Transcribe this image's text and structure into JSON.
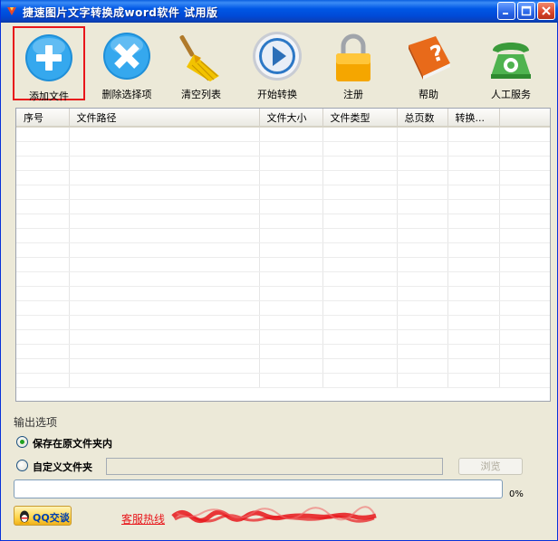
{
  "window": {
    "title": "捷速图片文字转换成word软件 试用版",
    "controls": [
      "minimize-icon",
      "maximize-icon",
      "close-icon"
    ]
  },
  "toolbar": {
    "items": [
      {
        "label": "添加文件",
        "icon": "add-plus-icon",
        "selected": true
      },
      {
        "label": "删除选择项",
        "icon": "delete-x-icon",
        "selected": false
      },
      {
        "label": "清空列表",
        "icon": "broom-icon",
        "selected": false
      },
      {
        "label": "开始转换",
        "icon": "play-icon",
        "selected": false
      },
      {
        "label": "注册",
        "icon": "lock-icon",
        "selected": false
      },
      {
        "label": "帮助",
        "icon": "help-book-icon",
        "selected": false
      },
      {
        "label": "人工服务",
        "icon": "telephone-icon",
        "selected": false
      }
    ]
  },
  "file_list": {
    "columns": [
      "序号",
      "文件路径",
      "文件大小",
      "文件类型",
      "总页数",
      "转换..."
    ],
    "rows": []
  },
  "output": {
    "section_title": "输出选项",
    "option_same_folder": "保存在原文件夹内",
    "option_custom_folder": "自定义文件夹",
    "selected_option": "保存在原文件夹内",
    "custom_folder_value": "",
    "browse_label": "浏览"
  },
  "progress": {
    "value_percent": 0,
    "label": "0%"
  },
  "footer": {
    "qq_button_label": "QQ交谈",
    "hotline_label": "客服热线"
  },
  "colors": {
    "titlebar": "#0058e6",
    "selection_border": "#e8161b",
    "hotline_text": "#e8161b"
  }
}
